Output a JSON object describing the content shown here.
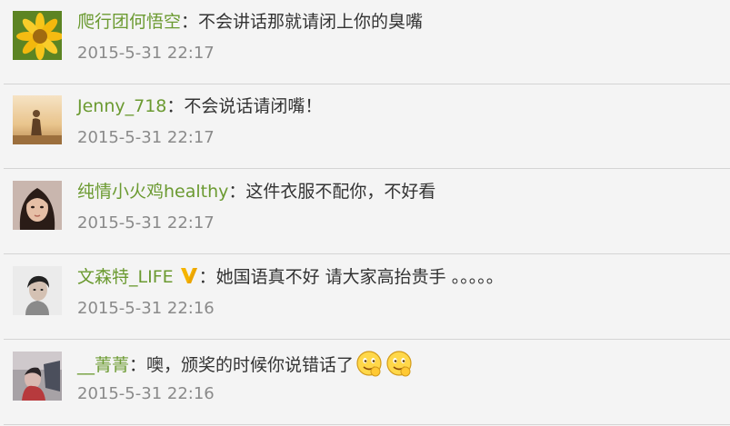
{
  "comments": [
    {
      "username": "爬行团何悟空",
      "separator": "：",
      "text": "不会讲话那就请闭上你的臭嘴",
      "time": "2015-5-31 22:17",
      "avatar_icon": "sunflower-avatar"
    },
    {
      "username": "Jenny_718",
      "separator": "：",
      "text": "不会说话请闭嘴！",
      "time": "2015-5-31 22:17",
      "avatar_icon": "sunset-person-avatar"
    },
    {
      "username": "纯情小火鸡healthy",
      "separator": "：",
      "text": "这件衣服不配你，不好看",
      "time": "2015-5-31 22:17",
      "avatar_icon": "girl-portrait-avatar"
    },
    {
      "username": "文森特_LIFE",
      "separator": "：",
      "text": "她国语真不好 请大家高抬贵手 。。。。。",
      "time": "2015-5-31 22:16",
      "avatar_icon": "boy-portrait-avatar",
      "verified_badge": "verified-v-icon"
    },
    {
      "username": "__菁菁",
      "separator": "：",
      "text": "噢，颁奖的时候你说错话了",
      "time": "2015-5-31 22:16",
      "avatar_icon": "dark-photo-avatar",
      "emojis": [
        "smile-emoji-icon",
        "smile-emoji-icon"
      ]
    }
  ],
  "colors": {
    "username": "#6b9a31",
    "text": "#333333",
    "time": "#8a8a8a",
    "background": "#f4f4f4",
    "divider": "#d4d4d4",
    "verified_badge": "#f5b400"
  }
}
